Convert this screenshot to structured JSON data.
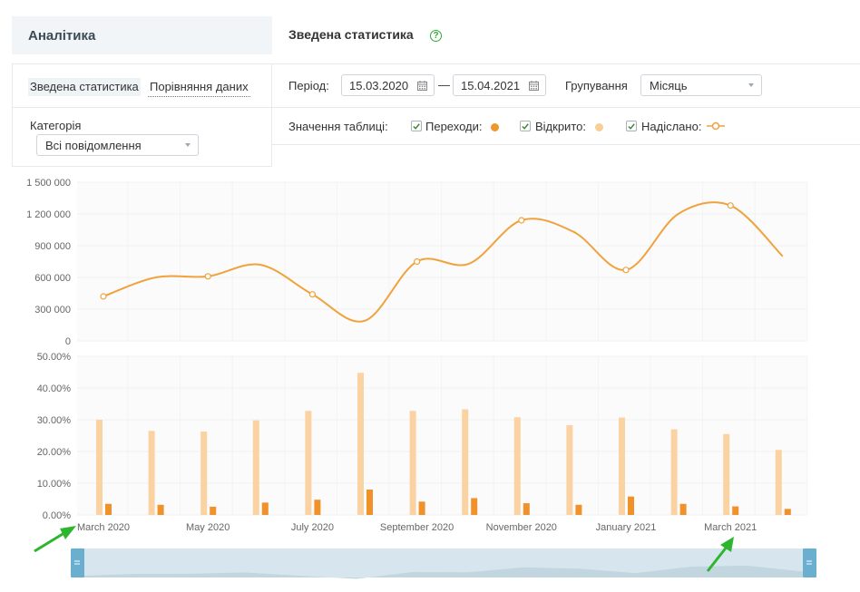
{
  "left": {
    "title": "Аналітика",
    "tabs": [
      {
        "label": "Зведена статистика"
      },
      {
        "label": "Порівняння даних"
      }
    ],
    "category_label": "Категорія",
    "category_value": "Всі повідомлення"
  },
  "right": {
    "title": "Зведена статистика",
    "help": "?",
    "period_label": "Період:",
    "date_from": "15.03.2020",
    "date_sep": "—",
    "date_to": "15.04.2021",
    "grouping_label": "Групування",
    "grouping_value": "Місяць",
    "table_values_label": "Значення таблиці:",
    "legend": [
      {
        "label": "Переходи:",
        "checked": true,
        "color": "#f0962a",
        "marker": "dot"
      },
      {
        "label": "Відкрито:",
        "checked": true,
        "color": "#f9cf96",
        "marker": "dot"
      },
      {
        "label": "Надіслано:",
        "checked": true,
        "color": "#f0a23c",
        "marker": "line-circle"
      }
    ]
  },
  "colors": {
    "line": "#f0a23c",
    "bar_opened": "#fbd3a3",
    "bar_clicks": "#f0912a",
    "check": "#3a8a3a",
    "scrollbar_handle": "#6aaed0",
    "scrollbar_bg": "#d7e6ee"
  },
  "chart_data": [
    {
      "type": "line",
      "series": [
        {
          "name": "Надіслано",
          "x": [
            "2020-03",
            "2020-04",
            "2020-05",
            "2020-06",
            "2020-07",
            "2020-08",
            "2020-09",
            "2020-10",
            "2020-11",
            "2020-12",
            "2021-01",
            "2021-02",
            "2021-03",
            "2021-04"
          ],
          "values": [
            420000,
            600000,
            610000,
            720000,
            440000,
            190000,
            750000,
            730000,
            1140000,
            1030000,
            670000,
            1200000,
            1280000,
            800000
          ]
        }
      ],
      "y_ticks": [
        "1 500 000",
        "1 200 000",
        "900 000",
        "600 000",
        "300 000",
        "0"
      ],
      "ylim": [
        0,
        1500000
      ],
      "grid": true
    },
    {
      "type": "bar",
      "categories": [
        "2020-03",
        "2020-04",
        "2020-05",
        "2020-06",
        "2020-07",
        "2020-08",
        "2020-09",
        "2020-10",
        "2020-11",
        "2020-12",
        "2021-01",
        "2021-02",
        "2021-03",
        "2021-04"
      ],
      "series": [
        {
          "name": "Відкрито",
          "values": [
            30.0,
            26.5,
            26.3,
            29.8,
            32.8,
            44.8,
            32.8,
            33.3,
            30.8,
            28.3,
            30.7,
            27.0,
            25.5,
            20.5
          ]
        },
        {
          "name": "Переходи",
          "values": [
            3.5,
            3.2,
            2.6,
            3.9,
            4.8,
            8.0,
            4.2,
            5.3,
            3.7,
            3.2,
            5.8,
            3.5,
            2.7,
            1.9
          ]
        }
      ],
      "y_ticks": [
        "50.00%",
        "40.00%",
        "30.00%",
        "20.00%",
        "10.00%",
        "0.00%"
      ],
      "ylim": [
        0,
        50
      ],
      "x_tick_labels": [
        "March 2020",
        "May 2020",
        "July 2020",
        "September 2020",
        "November 2020",
        "January 2021",
        "March 2021"
      ],
      "grid": true
    }
  ]
}
